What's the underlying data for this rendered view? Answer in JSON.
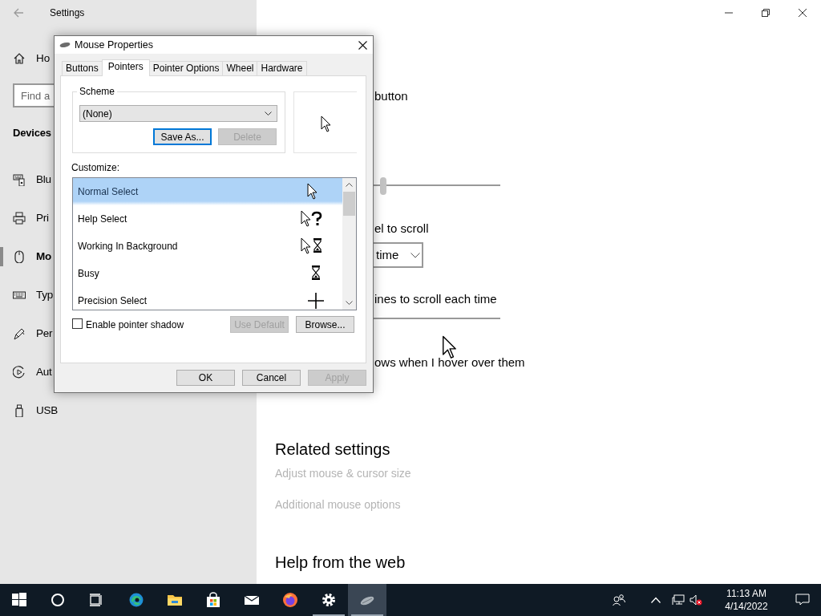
{
  "settings": {
    "title": "Settings",
    "sidebar": {
      "home": "Ho",
      "search_placeholder": "Find a",
      "section": "Devices",
      "items": [
        {
          "kind": "bluetooth",
          "label": "Blu",
          "selected": false
        },
        {
          "kind": "printer",
          "label": "Pri",
          "selected": false
        },
        {
          "kind": "mouse",
          "label": "Mo",
          "selected": true
        },
        {
          "kind": "keyboard",
          "label": "Typ",
          "selected": false
        },
        {
          "kind": "pen",
          "label": "Per",
          "selected": false
        },
        {
          "kind": "autoplay",
          "label": "Aut",
          "selected": false
        },
        {
          "kind": "usb",
          "label": "USB",
          "selected": false
        }
      ]
    },
    "content": {
      "rows": [
        {
          "kind": "text",
          "text": "button"
        },
        {
          "kind": "slider",
          "level": 0.48
        },
        {
          "kind": "text",
          "text": "el to scroll"
        },
        {
          "kind": "dropdown",
          "value": "time"
        },
        {
          "kind": "text",
          "text": "ines to scroll each time"
        },
        {
          "kind": "track"
        },
        {
          "kind": "text",
          "text": "ows when I hover over them"
        }
      ],
      "related": {
        "heading": "Related settings",
        "links": [
          {
            "label": "Adjust mouse & cursor size",
            "disabled": true
          },
          {
            "label": "Additional mouse options",
            "disabled": true
          }
        ]
      },
      "help_heading": "Help from the web"
    }
  },
  "dialog": {
    "title": "Mouse Properties",
    "tabs": [
      {
        "label": "Buttons",
        "selected": false
      },
      {
        "label": "Pointers",
        "selected": true
      },
      {
        "label": "Pointer Options",
        "selected": false
      },
      {
        "label": "Wheel",
        "selected": false
      },
      {
        "label": "Hardware",
        "selected": false
      }
    ],
    "scheme": {
      "label": "Scheme",
      "value": "(None)",
      "buttons": [
        {
          "label": "Save As...",
          "disabled": false,
          "focused": true
        },
        {
          "label": "Delete",
          "disabled": true,
          "focused": false
        }
      ]
    },
    "customize_label": "Customize:",
    "pointers": [
      {
        "label": "Normal Select",
        "kind": "arrow",
        "selected": true
      },
      {
        "label": "Help Select",
        "kind": "help",
        "selected": false
      },
      {
        "label": "Working In Background",
        "kind": "working",
        "selected": false
      },
      {
        "label": "Busy",
        "kind": "busy",
        "selected": false
      },
      {
        "label": "Precision Select",
        "kind": "cross",
        "selected": false
      }
    ],
    "shadow": {
      "label": "Enable pointer shadow",
      "checked": false
    },
    "pointer_buttons": [
      {
        "label": "Use Default",
        "disabled": true
      },
      {
        "label": "Browse...",
        "disabled": false
      }
    ],
    "footer_buttons": [
      {
        "label": "OK",
        "disabled": false
      },
      {
        "label": "Cancel",
        "disabled": false
      },
      {
        "label": "Apply",
        "disabled": true
      }
    ]
  },
  "taskbar": {
    "apps": [
      {
        "kind": "edge",
        "running": false,
        "selected": false
      },
      {
        "kind": "folder",
        "running": false,
        "selected": false
      },
      {
        "kind": "store",
        "running": false,
        "selected": false
      },
      {
        "kind": "mail",
        "running": false,
        "selected": false
      },
      {
        "kind": "firefox",
        "running": false,
        "selected": false
      },
      {
        "kind": "settings",
        "running": true,
        "selected": false
      },
      {
        "kind": "mouse",
        "running": true,
        "selected": true
      }
    ],
    "clock": {
      "time": "11:13 AM",
      "date": "4/14/2022"
    }
  }
}
